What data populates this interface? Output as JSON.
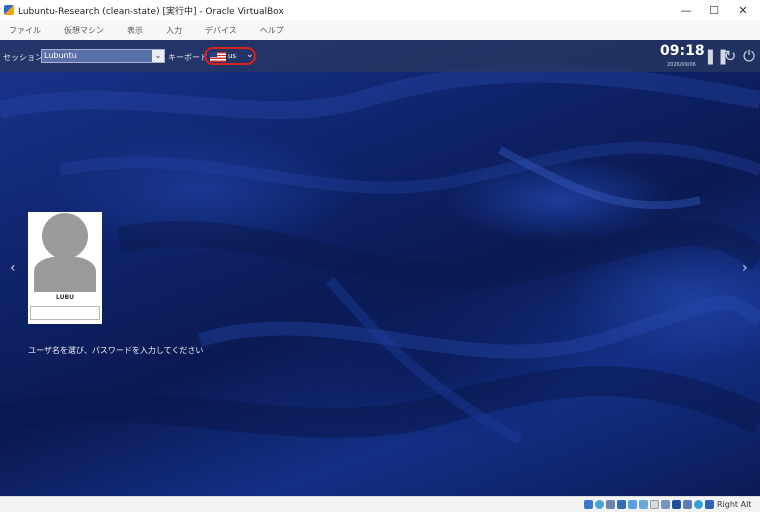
{
  "window": {
    "title": "Lubuntu-Research (clean-state) [実行中] - Oracle VirtualBox",
    "controls": {
      "minimize": "—",
      "maximize": "☐",
      "close": "✕"
    }
  },
  "menu": {
    "items": [
      "ファイル",
      "仮想マシン",
      "表示",
      "入力",
      "デバイス",
      "ヘルプ"
    ]
  },
  "topbar": {
    "session_label": "セッション",
    "session_value": "Lubuntu",
    "keyboard_label": "キーボード",
    "keyboard_value": "us",
    "clock": "09:18",
    "date": "2026/09/06",
    "icons": [
      "pause-icon",
      "restart-icon",
      "power-icon"
    ]
  },
  "login": {
    "username": "LUBU",
    "password_value": "",
    "prompt": "ユーザ名を選び、パスワードを入力してください",
    "prev_arrow": "‹",
    "next_arrow": "›"
  },
  "statusbar": {
    "host_key": "Right Alt"
  },
  "colors": {
    "highlight": "#d8201e",
    "topbar": "#28375f",
    "background": "#0e2268"
  }
}
